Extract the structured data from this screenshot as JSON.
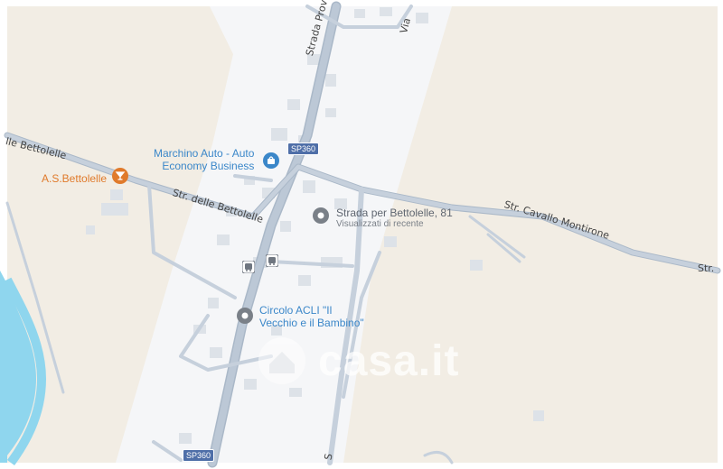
{
  "map": {
    "watermark": "casa.it",
    "colors": {
      "land": "#f2ede4",
      "urban": "#f5f6f8",
      "road": "#bcc8d6",
      "road_edge": "#aab8c8",
      "river": "#8fd6ee",
      "building": "#dde2e8",
      "poi_blue": "#3b87c9",
      "poi_orange": "#e07a2b",
      "shield": "#4f6fa8"
    },
    "road_labels": {
      "provinciale": "Strada Provinciale",
      "via_top": "Via",
      "bettolelle_left": "lle Bettolelle",
      "bettolelle_mid": "Str. delle Bettolelle",
      "cavallo": "Str. Cavallo Montirone",
      "right_edge": "Str.",
      "bottom_s": "S",
      "bottom_s2": "S"
    },
    "shields": {
      "top": "SP360",
      "bottom": "SP360"
    },
    "pois": {
      "marchino_line1": "Marchino Auto - Auto",
      "marchino_line2": "Economy Business",
      "bettolelle_club": "A.S.Bettolelle",
      "recent_address": "Strada per Bettolelle, 81",
      "recent_sub": "Visualizzati di recente",
      "circolo_line1": "Circolo ACLI \"Il",
      "circolo_line2": "Vecchio e il Bambino\""
    },
    "icons": [
      "shopping-bag-icon",
      "bar-icon",
      "place-pin-icon",
      "bus-stop-icon"
    ]
  }
}
